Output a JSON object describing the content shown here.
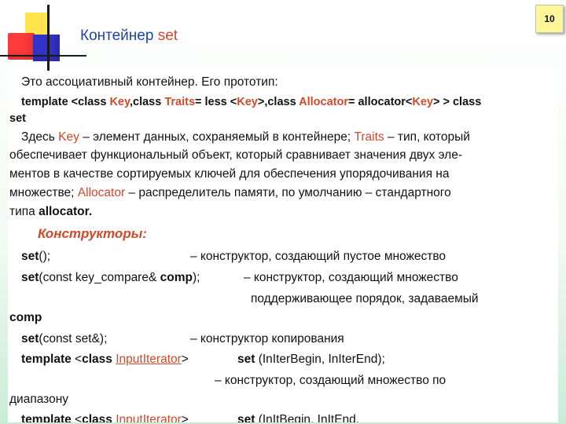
{
  "slide": {
    "page_number": "10",
    "title": {
      "prefix": "Контейнер ",
      "keyword": "set"
    }
  },
  "paragraphs": {
    "intro": "Это ассоциативный контейнер. Его прототип:",
    "prototype": {
      "w1": "template",
      "w2": " <class ",
      "w3": "Key",
      "w4": ",class ",
      "w5": "Traits",
      "w6": "= ",
      "w7": "less",
      "w8": " <",
      "w9": "Key",
      "w10": ">,class ",
      "w11": "Allocator",
      "w12": "= ",
      "w13": "allocator",
      "w14": "<",
      "w15": "Key",
      "w16": "> > class",
      "line2": "set"
    },
    "desc": {
      "a1": "Здесь ",
      "a2": "Key",
      "a3": " – элемент данных, сохраняемый в контейнере; ",
      "a4": "Traits",
      "a5": " – тип, который",
      "l2": "обеспечивает функциональный объект, который сравнивает значения двух эле-",
      "l3": "ментов в качестве сортируемых ключей для обеспечения упорядочивания на",
      "b1": "множестве; ",
      "b2": "Allocator",
      "b3": " – распределитель памяти, по умолчанию – стандартного",
      "c1": "типа ",
      "c2": "allocator."
    },
    "constructors_heading": "Конструкторы:",
    "ctor1": {
      "name": "set",
      "args": "();",
      "desc": "– конструктор, создающий пустое множество"
    },
    "ctor2": {
      "name": "set",
      "args1": "(const key_compare& ",
      "arg_b": "comp",
      "args2": ");",
      "desc": "– конструктор, создающий множество",
      "desc2": "поддерживающее порядок, задаваемый",
      "desc3": "comp"
    },
    "ctor3": {
      "name": "set",
      "args": "(const  set&);",
      "desc": "– конструктор копирования"
    },
    "ctor4": {
      "t1": "template",
      "t2": " <",
      "t3": "class",
      "t4": " ",
      "t5": "InputIterator",
      "t6": ">",
      "name": "set",
      "args": " (InIterBegin, InIterEnd);",
      "desc": "– конструктор, создающий множество по",
      "desc2": "диапазону"
    },
    "ctor5": {
      "t1": "template",
      "t2": " <",
      "t3": "class",
      "t4": " ",
      "t5": "InputIterator",
      "t6": ">",
      "name": "set",
      "args": " (InItBegin, InItEnd,"
    }
  }
}
